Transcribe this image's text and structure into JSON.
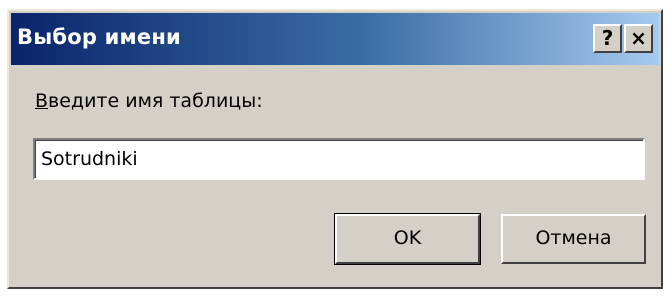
{
  "dialog": {
    "title": "Выбор имени",
    "help_button": "?",
    "close_button": "×"
  },
  "form": {
    "prompt_label_first": "В",
    "prompt_label_rest": "ведите имя таблицы:",
    "name_value": "Sotrudniki"
  },
  "buttons": {
    "ok_label": "OK",
    "cancel_label": "Отмена"
  },
  "colors": {
    "titlebar_start": "#0a246a",
    "titlebar_end": "#a6caf0",
    "dialog_face": "#d4d0c8"
  }
}
